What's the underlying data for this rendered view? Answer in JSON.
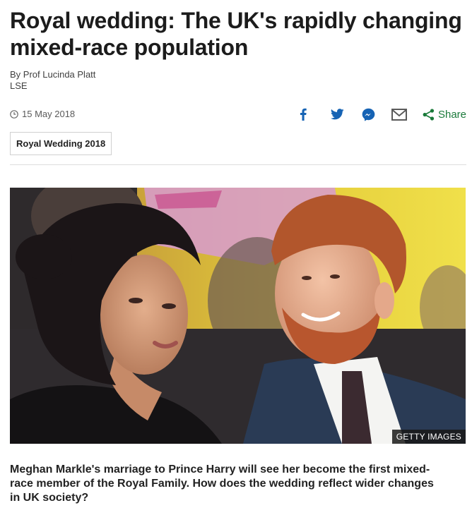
{
  "article": {
    "headline": "Royal wedding: The UK's rapidly changing mixed-race population",
    "author": "By Prof Lucinda Platt",
    "affiliation": "LSE",
    "date": "15 May 2018",
    "tag": "Royal Wedding 2018",
    "image_credit": "GETTY IMAGES",
    "intro": "Meghan Markle's marriage to Prince Harry will see her become the first mixed-race member of the Royal Family. How does the wedding reflect wider changes in UK society?"
  },
  "share": {
    "label": "Share",
    "icons": [
      "facebook-icon",
      "twitter-icon",
      "messenger-icon",
      "email-icon",
      "share-icon"
    ],
    "icon_color": "#1663b4",
    "share_color": "#1a7a3a"
  }
}
